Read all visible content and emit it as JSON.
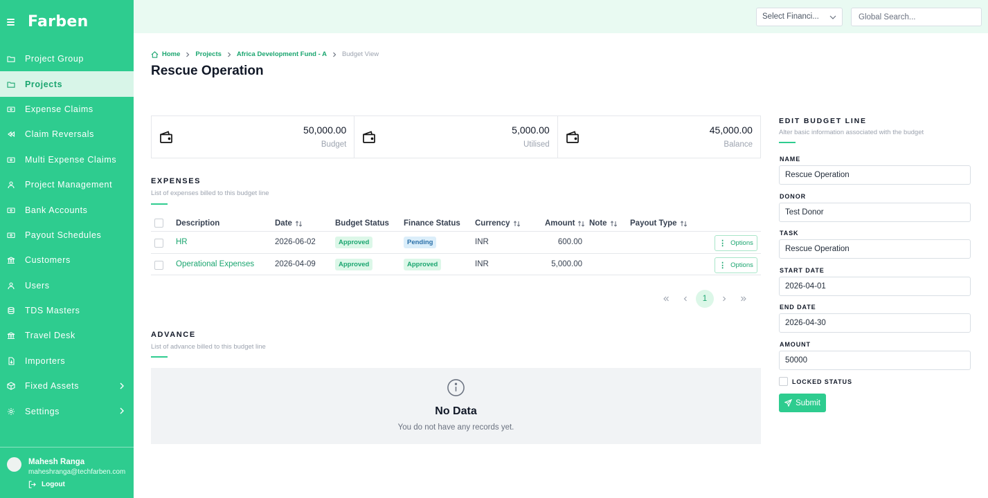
{
  "app": {
    "logo": "Farben"
  },
  "sidebar": {
    "items": [
      {
        "label": "Project Group",
        "icon": "folder-icon",
        "active": false
      },
      {
        "label": "Projects",
        "icon": "folder-icon",
        "active": true
      },
      {
        "label": "Expense Claims",
        "icon": "money-icon",
        "active": false
      },
      {
        "label": "Claim Reversals",
        "icon": "rewind-icon",
        "active": false
      },
      {
        "label": "Multi Expense Claims",
        "icon": "money-icon",
        "active": false
      },
      {
        "label": "Project Management",
        "icon": "user-icon",
        "active": false
      },
      {
        "label": "Bank Accounts",
        "icon": "money-icon",
        "active": false
      },
      {
        "label": "Payout Schedules",
        "icon": "money-icon",
        "active": false
      },
      {
        "label": "Customers",
        "icon": "bank-icon",
        "active": false
      },
      {
        "label": "Users",
        "icon": "user-icon",
        "active": false
      },
      {
        "label": "TDS Masters",
        "icon": "database-icon",
        "active": false
      },
      {
        "label": "Travel Desk",
        "icon": "bank-icon",
        "active": false
      },
      {
        "label": "Importers",
        "icon": "import-icon",
        "active": false
      },
      {
        "label": "Fixed Assets",
        "icon": "box-icon",
        "active": false,
        "expandable": true
      },
      {
        "label": "Settings",
        "icon": "gear-icon",
        "active": false,
        "expandable": true
      }
    ],
    "user": {
      "name": "Mahesh Ranga",
      "email": "maheshranga@techfarben.com",
      "logout": "Logout"
    }
  },
  "topbar": {
    "financial_select": "Select Financi...",
    "search_placeholder": "Global Search..."
  },
  "breadcrumb": {
    "home": "Home",
    "projects": "Projects",
    "project": "Africa Development Fund - A",
    "current": "Budget View"
  },
  "page_title": "Rescue Operation",
  "stats": [
    {
      "value": "50,000.00",
      "label": "Budget"
    },
    {
      "value": "5,000.00",
      "label": "Utilised"
    },
    {
      "value": "45,000.00",
      "label": "Balance"
    }
  ],
  "expenses": {
    "title": "EXPENSES",
    "subtitle": "List of expenses billed to this budget line",
    "columns": {
      "description": "Description",
      "date": "Date",
      "budget_status": "Budget Status",
      "finance_status": "Finance Status",
      "currency": "Currency",
      "amount": "Amount",
      "note": "Note",
      "payout_type": "Payout Type"
    },
    "rows": [
      {
        "description": "HR",
        "date": "2026-06-02",
        "budget_status": "Approved",
        "finance_status": "Pending",
        "currency": "INR",
        "amount": "600.00",
        "options": "Options"
      },
      {
        "description": "Operational Expenses",
        "date": "2026-04-09",
        "budget_status": "Approved",
        "finance_status": "Approved",
        "currency": "INR",
        "amount": "5,000.00",
        "options": "Options"
      }
    ],
    "pagination": {
      "current_page": "1"
    }
  },
  "advance": {
    "title": "ADVANCE",
    "subtitle": "List of advance billed to this budget line",
    "empty_title": "No Data",
    "empty_sub": "You do not have any records yet."
  },
  "form": {
    "title": "EDIT BUDGET LINE",
    "subtitle": "Alter basic information associated with the budget",
    "name_label": "NAME",
    "name_value": "Rescue Operation",
    "donor_label": "DONOR",
    "donor_value": "Test Donor",
    "task_label": "TASK",
    "task_value": "Rescue Operation",
    "start_label": "START DATE",
    "start_value": "2026-04-01",
    "end_label": "END DATE",
    "end_value": "2026-04-30",
    "amount_label": "AMOUNT",
    "amount_value": "50000",
    "locked_label": "LOCKED STATUS",
    "submit": "Submit"
  },
  "colors": {
    "primary": "#2ecc8f",
    "primary_dark": "#1aa56f",
    "active_bg": "#d8f5e8",
    "topbar_bg": "#e9faf2"
  }
}
